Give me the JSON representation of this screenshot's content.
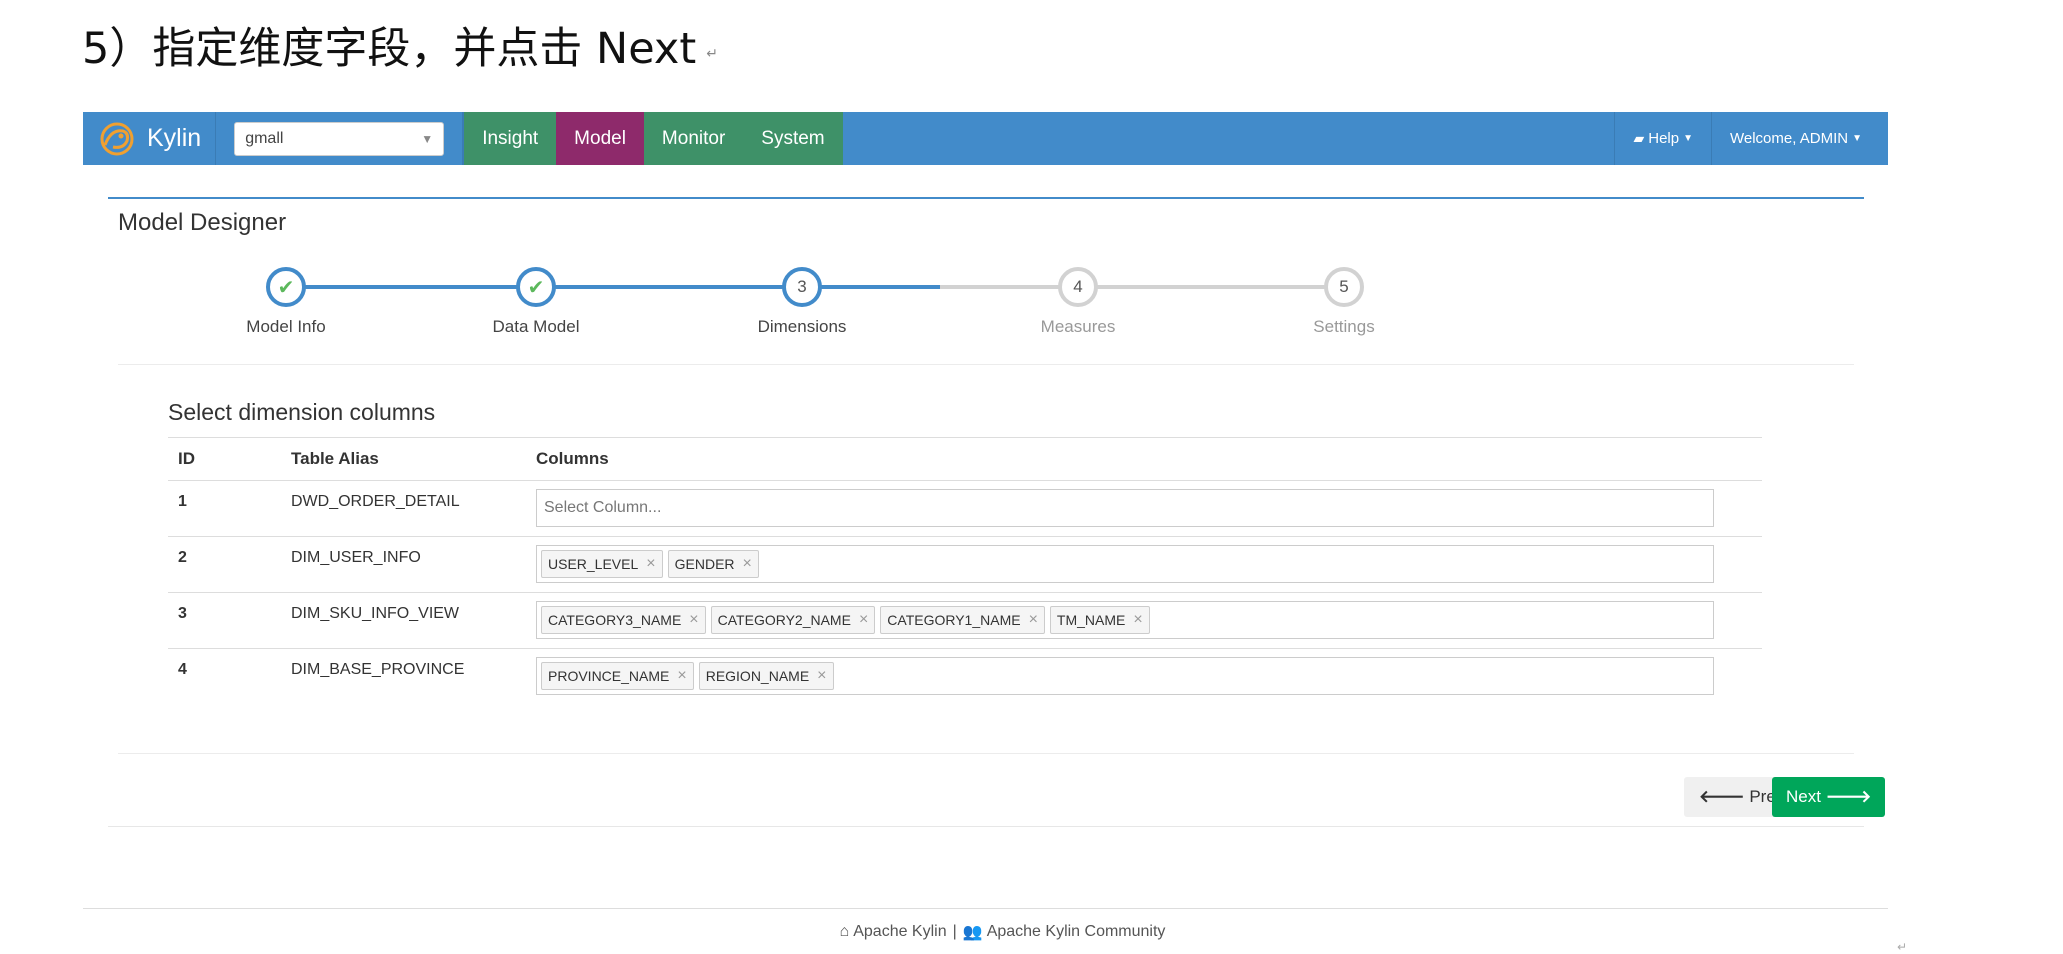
{
  "doc": {
    "heading": "5）指定维度字段，并点击 Next",
    "para_mark": "↵",
    "corner_mark": "↵"
  },
  "navbar": {
    "brand": "Kylin",
    "brand_logo": "kylin-logo-icon",
    "project": "gmall",
    "items": [
      {
        "label": "Insight",
        "active": false
      },
      {
        "label": "Model",
        "active": true
      },
      {
        "label": "Monitor",
        "active": false
      },
      {
        "label": "System",
        "active": false
      }
    ],
    "help": "Help",
    "welcome": "Welcome, ADMIN",
    "colors": {
      "bar": "#428bca",
      "item": "#3e9168",
      "active": "#8e2a6b"
    }
  },
  "panel": {
    "title": "Model Designer"
  },
  "wizard": {
    "steps": [
      {
        "num": "1",
        "label": "Model Info",
        "state": "done"
      },
      {
        "num": "2",
        "label": "Data Model",
        "state": "done"
      },
      {
        "num": "3",
        "label": "Dimensions",
        "state": "current"
      },
      {
        "num": "4",
        "label": "Measures",
        "state": "todo"
      },
      {
        "num": "5",
        "label": "Settings",
        "state": "todo"
      }
    ]
  },
  "dimensions": {
    "title": "Select dimension columns",
    "headers": {
      "id": "ID",
      "alias": "Table Alias",
      "columns": "Columns"
    },
    "placeholder": "Select Column...",
    "rows": [
      {
        "id": "1",
        "alias": "DWD_ORDER_DETAIL",
        "columns": []
      },
      {
        "id": "2",
        "alias": "DIM_USER_INFO",
        "columns": [
          "USER_LEVEL",
          "GENDER"
        ]
      },
      {
        "id": "3",
        "alias": "DIM_SKU_INFO_VIEW",
        "columns": [
          "CATEGORY3_NAME",
          "CATEGORY2_NAME",
          "CATEGORY1_NAME",
          "TM_NAME"
        ]
      },
      {
        "id": "4",
        "alias": "DIM_BASE_PROVINCE",
        "columns": [
          "PROVINCE_NAME",
          "REGION_NAME"
        ]
      }
    ]
  },
  "buttons": {
    "prev": "Prev",
    "next": "Next",
    "next_color": "#00a65a"
  },
  "footer": {
    "left": "Apache Kylin",
    "sep": "|",
    "right": "Apache Kylin Community"
  }
}
